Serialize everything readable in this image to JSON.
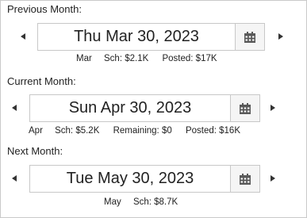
{
  "previous": {
    "label": "Previous Month:",
    "date": "Thu Mar 30, 2023",
    "month": "Mar",
    "sch": "Sch: $2.1K",
    "posted": "Posted: $17K"
  },
  "current": {
    "label": "Current Month:",
    "date": "Sun Apr 30, 2023",
    "month": "Apr",
    "sch": "Sch: $5.2K",
    "remaining": "Remaining: $0",
    "posted": "Posted: $16K"
  },
  "next": {
    "label": "Next Month:",
    "date": "Tue May 30, 2023",
    "month": "May",
    "sch": "Sch: $8.7K"
  },
  "colors": {
    "arrow": "#333333",
    "calendar_icon": "#5a5a5a",
    "border": "#c8c8c8"
  },
  "icons": {
    "prev": "caret-left-icon",
    "next": "caret-right-icon",
    "calendar": "calendar-icon"
  }
}
